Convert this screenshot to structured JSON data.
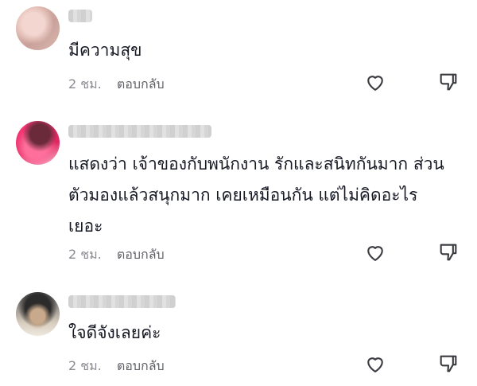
{
  "comments": [
    {
      "text": "มีความสุข",
      "time": "2 ชม.",
      "reply_label": "ตอบกลับ",
      "like_icon": "heart-icon",
      "dislike_icon": "thumbs-down-icon"
    },
    {
      "text": "แสดงว่า เจ้าของกับพนักงาน รักและสนิทกันมาก ส่วน\nตัวมองแล้วสนุกมาก เคยเหมือนกัน แต่ไม่คิดอะไร\nเยอะ",
      "time": "2 ชม.",
      "reply_label": "ตอบกลับ",
      "like_icon": "heart-icon",
      "dislike_icon": "thumbs-down-icon"
    },
    {
      "text": "ใจดีจังเลยค่ะ",
      "time": "2 ชม.",
      "reply_label": "ตอบกลับ",
      "like_icon": "heart-icon",
      "dislike_icon": "thumbs-down-icon"
    }
  ],
  "colors": {
    "text": "#161823",
    "meta": "#8a8b91",
    "icon": "#3a3b40"
  }
}
